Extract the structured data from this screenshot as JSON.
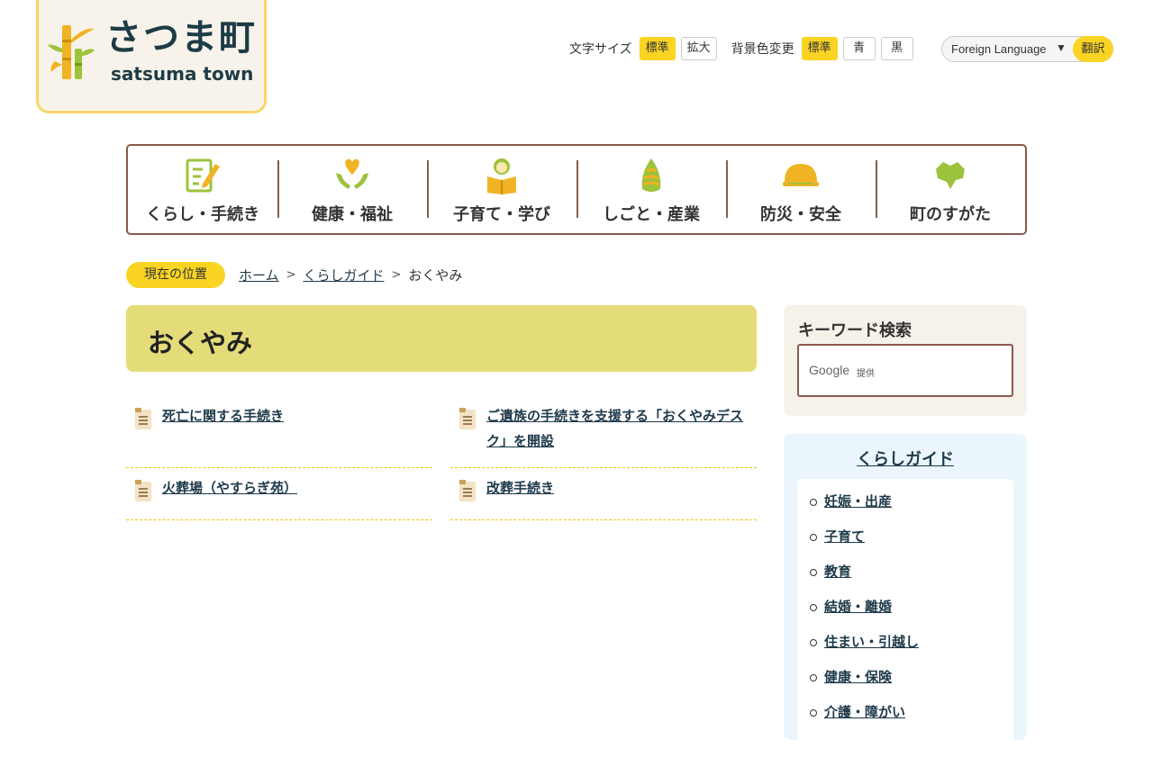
{
  "logo": {
    "jp": "さつま町",
    "en": "satsuma town"
  },
  "tools": {
    "font_size_label": "文字サイズ",
    "font_size_options": [
      "標準",
      "拡大"
    ],
    "bg_color_label": "背景色変更",
    "bg_color_options": [
      "標準",
      "青",
      "黒"
    ],
    "language_select": "Foreign Language",
    "translate_label": "翻訳"
  },
  "nav": {
    "items": [
      {
        "label": "くらし・手続き",
        "icon": "form-pen-icon"
      },
      {
        "label": "健康・福祉",
        "icon": "heart-hands-icon"
      },
      {
        "label": "子育て・学び",
        "icon": "child-book-icon"
      },
      {
        "label": "しごと・産業",
        "icon": "bamboo-shoot-icon"
      },
      {
        "label": "防災・安全",
        "icon": "helmet-icon"
      },
      {
        "label": "町のすがた",
        "icon": "town-map-icon"
      }
    ]
  },
  "breadcrumb": {
    "here_label": "現在の位置",
    "links": [
      "ホーム",
      "くらしガイド"
    ],
    "current": "おくやみ"
  },
  "page": {
    "title": "おくやみ",
    "links": [
      "死亡に関する手続き",
      "ご遺族の手続きを支援する「おくやみデスク」を開設",
      "火葬場（やすらぎ苑）",
      "改葬手続き"
    ]
  },
  "sidebar": {
    "search_title": "キーワード検索",
    "search_brand": "Google",
    "search_provided": "提供",
    "guide_title": "くらしガイド",
    "guide_items": [
      "妊娠・出産",
      "子育て",
      "教育",
      "結婚・離婚",
      "住まい・引越し",
      "健康・保険",
      "介護・障がい"
    ]
  },
  "colors": {
    "accent_yellow": "#f9d423",
    "nav_border": "#8a5a4d",
    "title_band": "#e4dc79",
    "link": "#1f3a4a"
  }
}
